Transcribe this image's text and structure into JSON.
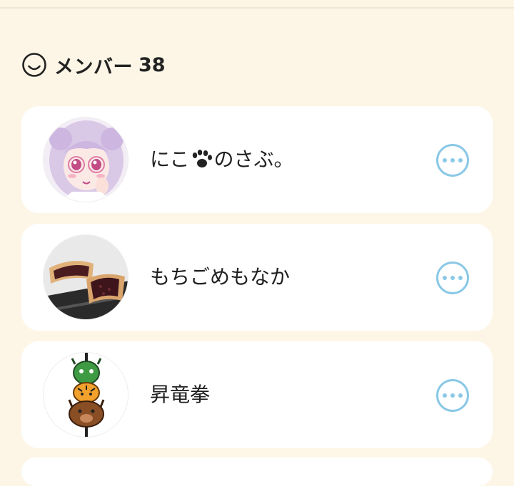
{
  "section": {
    "icon": "smile-face-icon",
    "label": "メンバー",
    "count": "38"
  },
  "members": [
    {
      "name_before": "にこ",
      "name_icon": "paw-icon",
      "name_after": "のさぶ。",
      "avatar_icon": "anime-girl-avatar",
      "more_icon": "more-options-icon"
    },
    {
      "name": "もちごめもなか",
      "avatar_icon": "monaka-sweet-avatar",
      "more_icon": "more-options-icon"
    },
    {
      "name": "昇竜拳",
      "avatar_icon": "dragon-tiger-boar-skewer-avatar",
      "more_icon": "more-options-icon"
    }
  ],
  "colors": {
    "background": "#fdf6e6",
    "card": "#ffffff",
    "accent_more": "#8ac8e6",
    "text": "#1f1f1f"
  }
}
